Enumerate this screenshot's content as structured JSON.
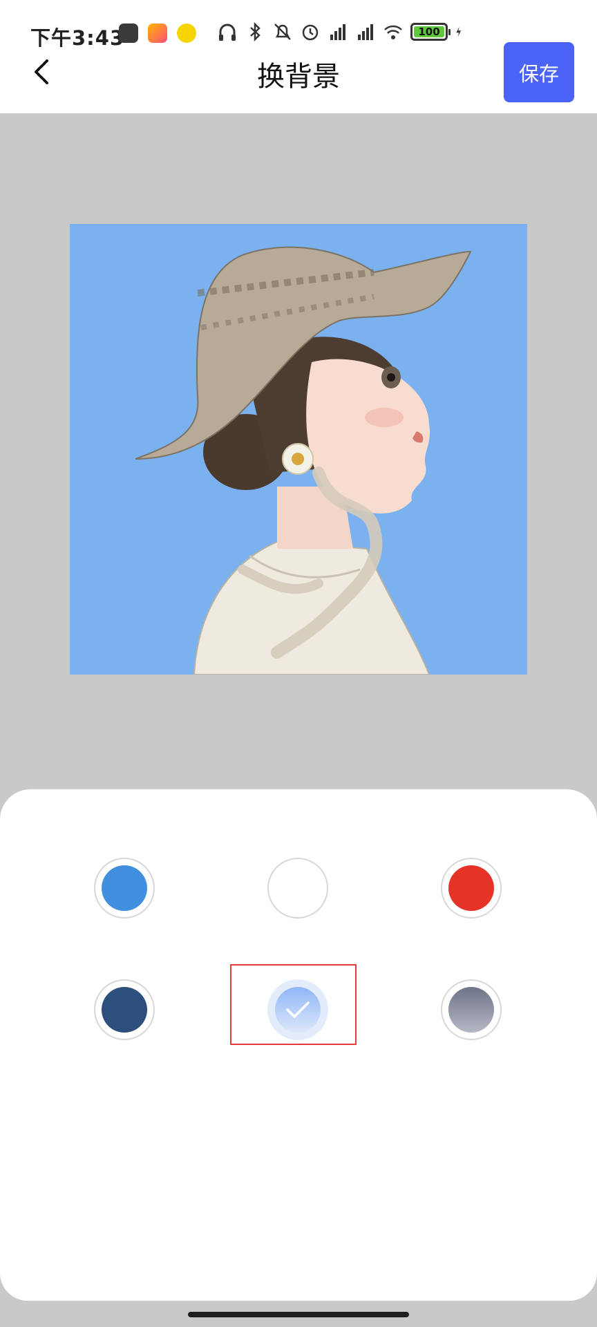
{
  "status_bar": {
    "time": "下午3:43",
    "battery": "100",
    "app_icons": [
      "app-icon-1",
      "app-icon-2",
      "app-icon-3"
    ],
    "system_icons": [
      "headphones-icon",
      "bluetooth-icon",
      "mute-bell-icon",
      "alarm-icon",
      "signal-hd-icon",
      "signal-hd-icon",
      "wifi-icon",
      "battery-icon",
      "charging-icon"
    ]
  },
  "header": {
    "title": "换背景",
    "back_icon": "chevron-left-icon",
    "save_label": "保存"
  },
  "colors": {
    "accent": "#4a63f5",
    "preview_background": "#7ab1ee",
    "canvas_background": "#c9c9c9",
    "selection_frame": "#e53b3b"
  },
  "palette": {
    "options": [
      {
        "name": "blue",
        "color": "#418fdf",
        "selected": false
      },
      {
        "name": "white",
        "color": "#ffffff",
        "selected": false
      },
      {
        "name": "red",
        "color": "#e63327",
        "selected": false
      },
      {
        "name": "navy",
        "color": "#2d4f7d",
        "selected": false
      },
      {
        "name": "blue-gradient",
        "color": "#8fb6f5",
        "selected": true,
        "icon": "check-icon"
      },
      {
        "name": "gray-gradient",
        "color": "#7e8298",
        "selected": false
      }
    ]
  }
}
